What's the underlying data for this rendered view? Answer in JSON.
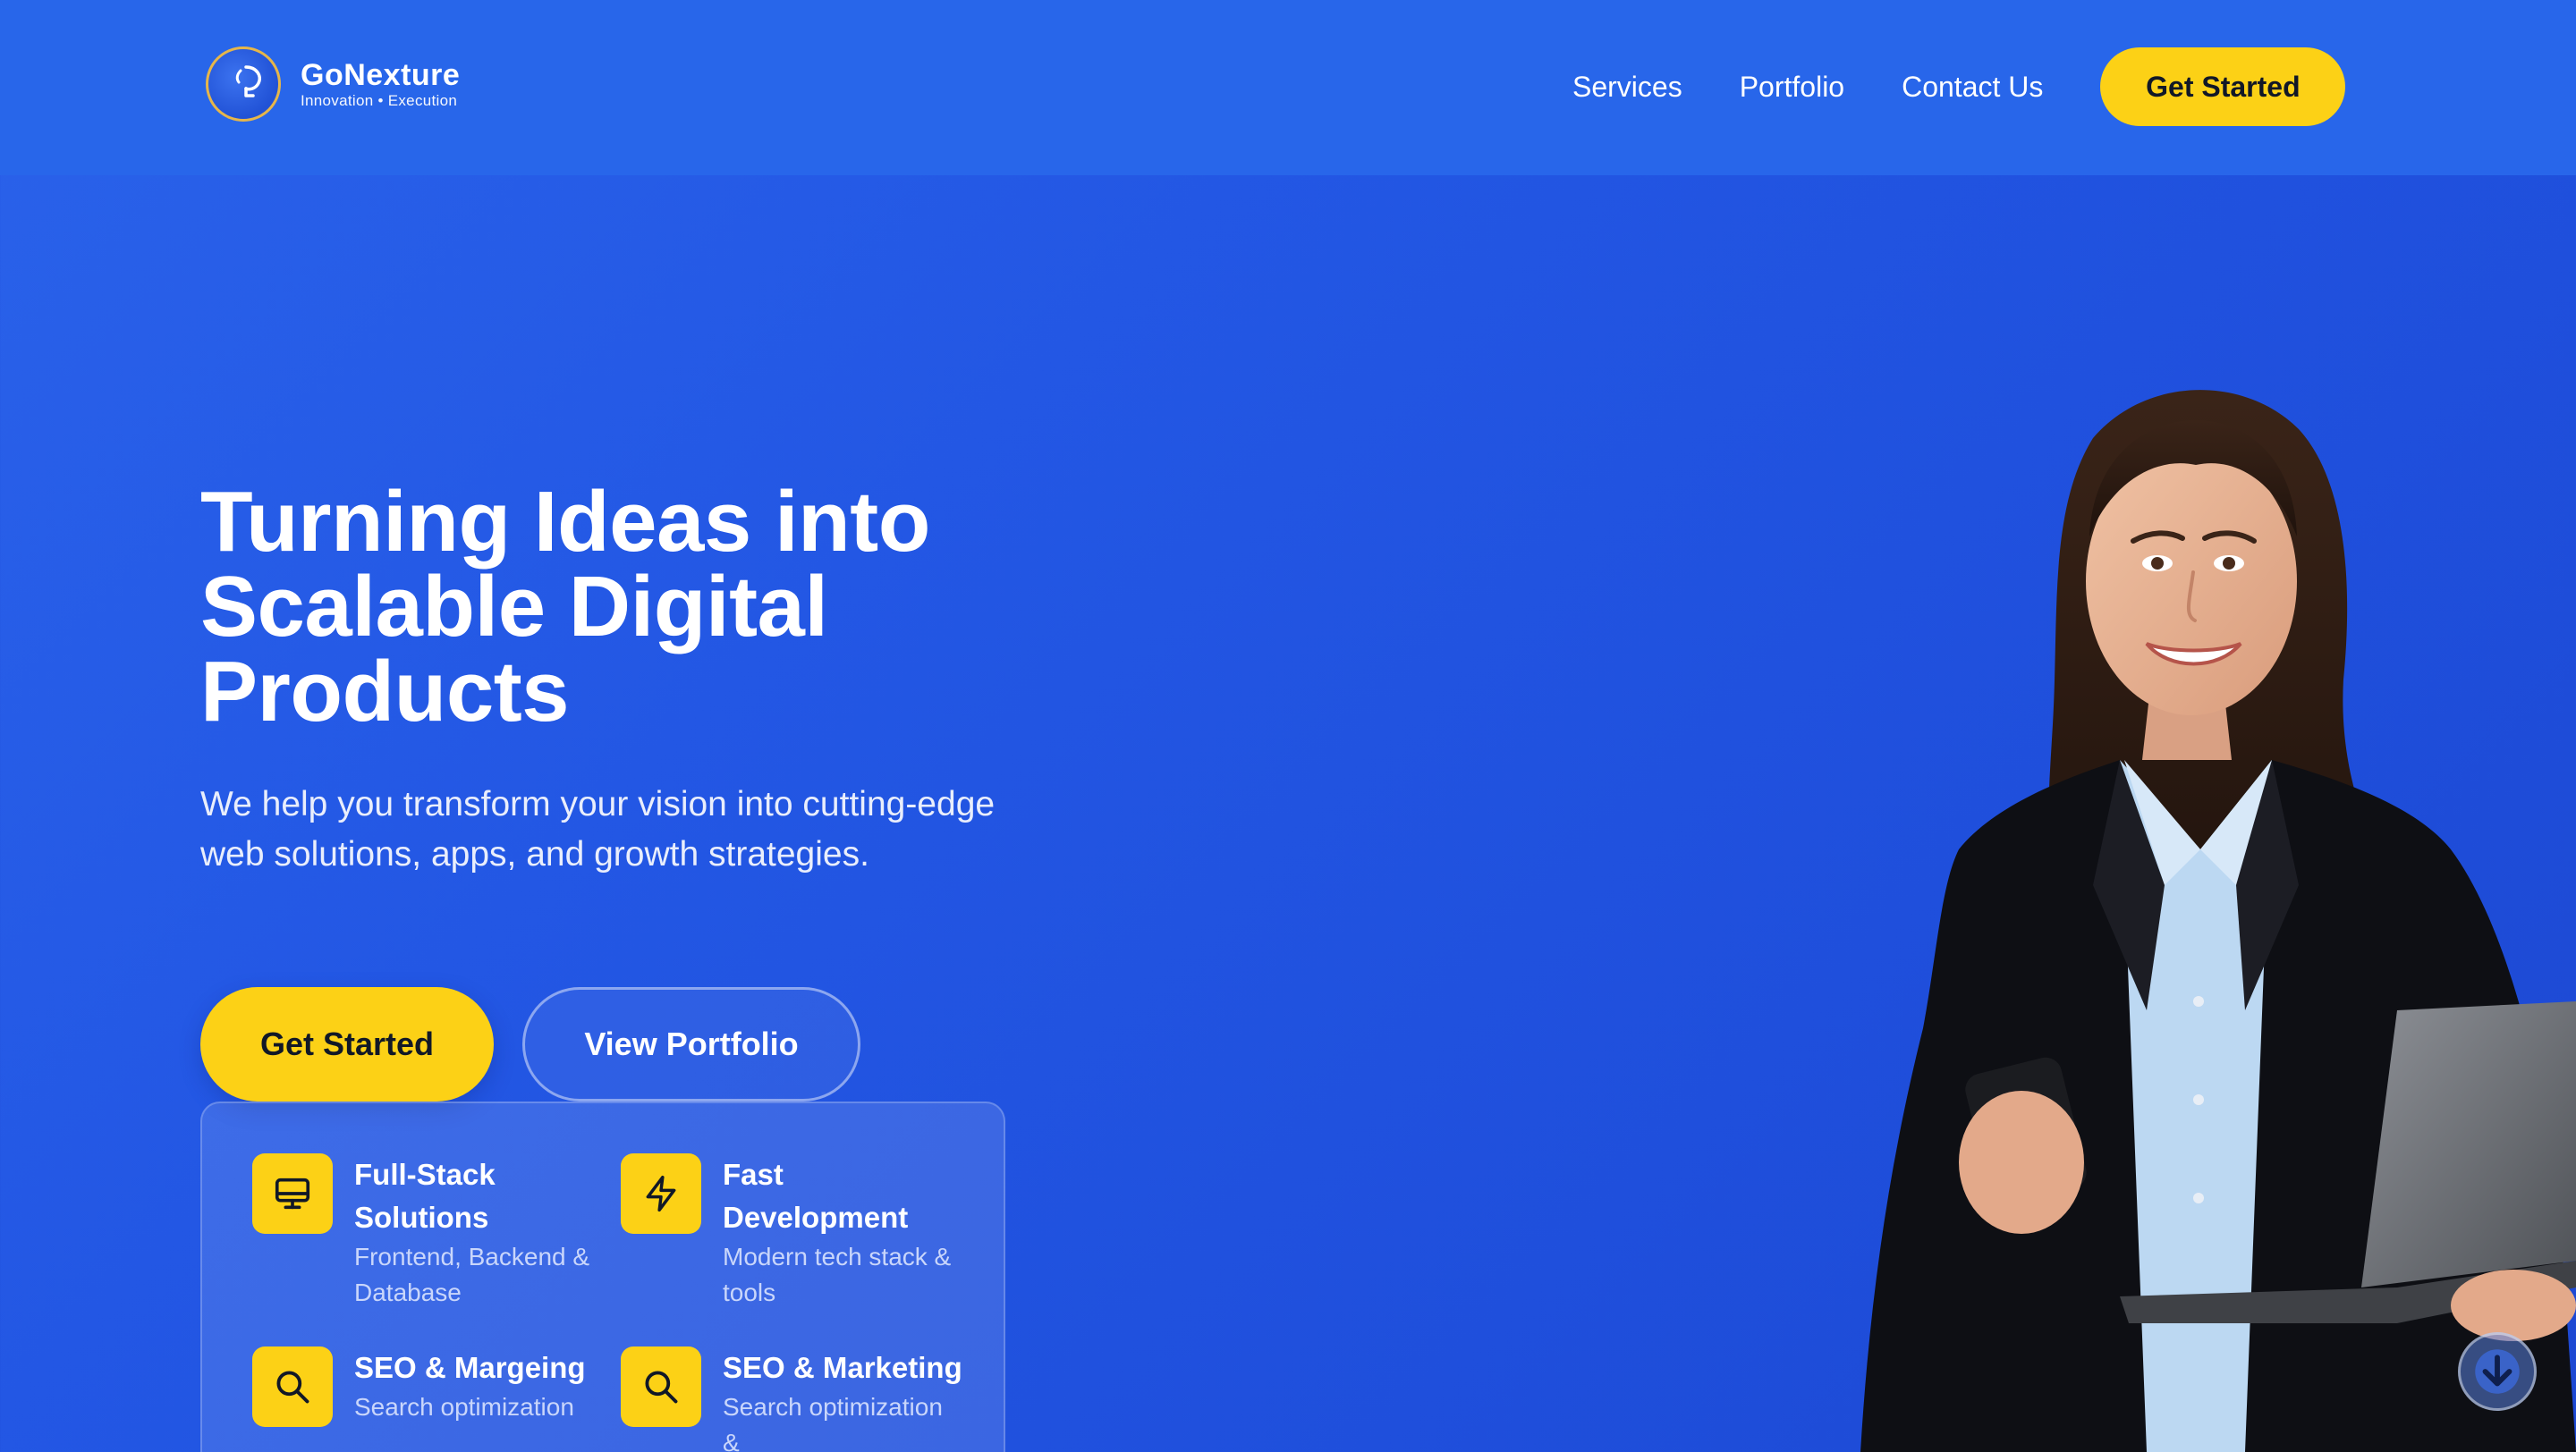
{
  "header": {
    "brand_name": "GoNexture",
    "brand_tagline": "Innovation • Execution",
    "nav": [
      {
        "label": "Services"
      },
      {
        "label": "Portfolio"
      },
      {
        "label": "Contact Us"
      }
    ],
    "cta_label": "Get Started"
  },
  "hero": {
    "title": "Turning Ideas into Scalable Digital Products",
    "subtitle": "We help you transform your vision into cutting-edge web solutions, apps, and growth strategies.",
    "primary_button": "Get Started",
    "secondary_button": "View Portfolio"
  },
  "features": [
    {
      "icon": "monitor-icon",
      "title": "Full-Stack Solutions",
      "description": "Frontend, Backend & Database"
    },
    {
      "icon": "lightning-icon",
      "title": "Fast Development",
      "description": "Modern tech stack & tools"
    },
    {
      "icon": "search-icon",
      "title": "SEO & Margeing",
      "description": "Search optimization"
    },
    {
      "icon": "search-icon",
      "title": "SEO & Marketing",
      "description": "Search optimization &"
    }
  ],
  "colors": {
    "background": "#2357e4",
    "header": "#2866ea",
    "accent": "#fcd116",
    "text_dark": "#111827"
  },
  "scroll_button": {
    "icon": "arrow-down-icon"
  }
}
